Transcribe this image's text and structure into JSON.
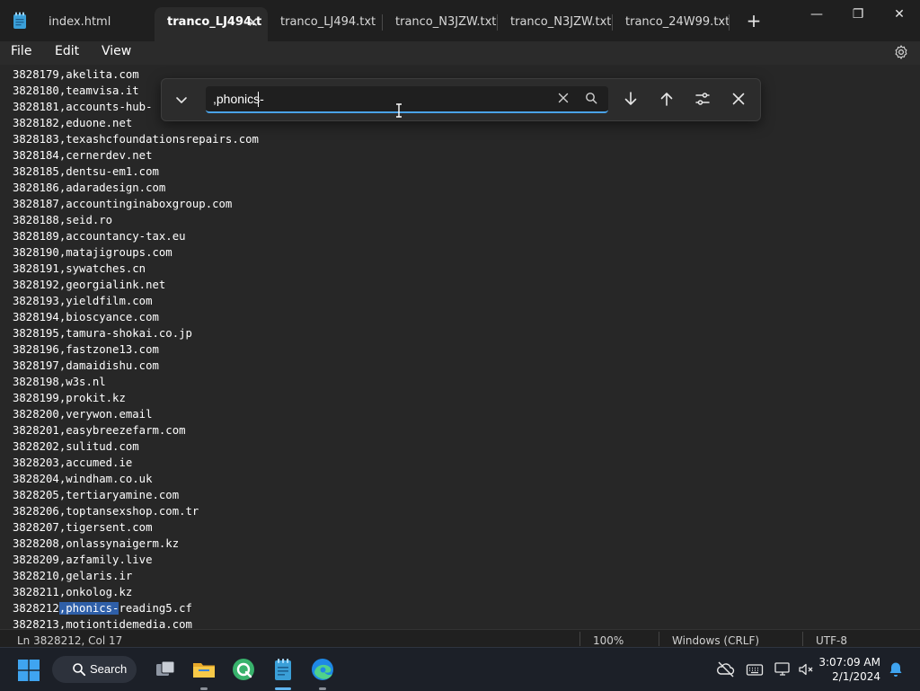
{
  "window": {
    "tabs": [
      {
        "label": "index.html",
        "active": false
      },
      {
        "label": "tranco_LJ494.t",
        "active": true
      },
      {
        "label": "tranco_LJ494.txt",
        "active": false
      },
      {
        "label": "tranco_N3JZW.txt",
        "active": false
      },
      {
        "label": "tranco_N3JZW.txt",
        "active": false
      },
      {
        "label": "tranco_24W99.txt",
        "active": false
      }
    ],
    "new_tab": "+",
    "controls": {
      "minimize": "—",
      "maximize": "❐",
      "close": "✕"
    }
  },
  "menu": {
    "file": "File",
    "edit": "Edit",
    "view": "View"
  },
  "find": {
    "query": ",phonics-"
  },
  "editor": {
    "lines": [
      {
        "num": "3828179",
        "domain": "akelita.com"
      },
      {
        "num": "3828180",
        "domain": "teamvisa.it"
      },
      {
        "num": "3828181",
        "domain": "accounts-hub-"
      },
      {
        "num": "3828182",
        "domain": "eduone.net"
      },
      {
        "num": "3828183",
        "domain": "texashcfoundationsrepairs.com"
      },
      {
        "num": "3828184",
        "domain": "cernerdev.net"
      },
      {
        "num": "3828185",
        "domain": "dentsu-em1.com"
      },
      {
        "num": "3828186",
        "domain": "adaradesign.com"
      },
      {
        "num": "3828187",
        "domain": "accountinginaboxgroup.com"
      },
      {
        "num": "3828188",
        "domain": "seid.ro"
      },
      {
        "num": "3828189",
        "domain": "accountancy-tax.eu"
      },
      {
        "num": "3828190",
        "domain": "matajigroups.com"
      },
      {
        "num": "3828191",
        "domain": "sywatches.cn"
      },
      {
        "num": "3828192",
        "domain": "georgialink.net"
      },
      {
        "num": "3828193",
        "domain": "yieldfilm.com"
      },
      {
        "num": "3828194",
        "domain": "bioscyance.com"
      },
      {
        "num": "3828195",
        "domain": "tamura-shokai.co.jp"
      },
      {
        "num": "3828196",
        "domain": "fastzone13.com"
      },
      {
        "num": "3828197",
        "domain": "damaidishu.com"
      },
      {
        "num": "3828198",
        "domain": "w3s.nl"
      },
      {
        "num": "3828199",
        "domain": "prokit.kz"
      },
      {
        "num": "3828200",
        "domain": "verywon.email"
      },
      {
        "num": "3828201",
        "domain": "easybreezefarm.com"
      },
      {
        "num": "3828202",
        "domain": "sulitud.com"
      },
      {
        "num": "3828203",
        "domain": "accumed.ie"
      },
      {
        "num": "3828204",
        "domain": "windham.co.uk"
      },
      {
        "num": "3828205",
        "domain": "tertiaryamine.com"
      },
      {
        "num": "3828206",
        "domain": "toptansexshop.com.tr"
      },
      {
        "num": "3828207",
        "domain": "tigersent.com"
      },
      {
        "num": "3828208",
        "domain": "onlassynaigerm.kz"
      },
      {
        "num": "3828209",
        "domain": "azfamily.live"
      },
      {
        "num": "3828210",
        "domain": "gelaris.ir"
      },
      {
        "num": "3828211",
        "domain": "onkolog.kz"
      },
      {
        "num": "3828212",
        "domain": "reading5.cf",
        "match": ",phonics-"
      },
      {
        "num": "3828213",
        "domain": "motiontidemedia.com"
      }
    ]
  },
  "status": {
    "position": "Ln 3828212, Col 17",
    "zoom": "100%",
    "line_ending": "Windows (CRLF)",
    "encoding": "UTF-8"
  },
  "taskbar": {
    "search_label": "Search",
    "time": "3:07:09 AM",
    "date": "2/1/2024"
  },
  "colors": {
    "accent": "#4aa3e8",
    "selection": "#2f5fa8"
  }
}
